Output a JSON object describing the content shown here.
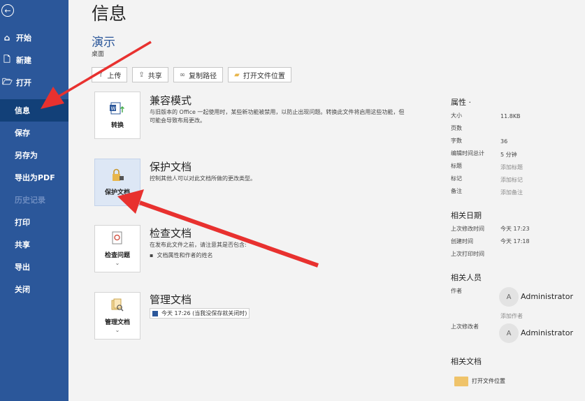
{
  "sidebar": {
    "back_icon": "back-arrow-icon",
    "top_items": [
      {
        "icon": "home-icon",
        "glyph": "⌂",
        "label": "开始"
      },
      {
        "icon": "new-doc-icon",
        "glyph": "🗋",
        "label": "新建"
      },
      {
        "icon": "open-folder-icon",
        "glyph": "🗁",
        "label": "打开"
      }
    ],
    "items": [
      {
        "label": "信息",
        "active": true
      },
      {
        "label": "保存"
      },
      {
        "label": "另存为"
      },
      {
        "label": "导出为PDF"
      },
      {
        "label": "历史记录",
        "disabled": true
      },
      {
        "label": "打印"
      },
      {
        "label": "共享"
      },
      {
        "label": "导出"
      },
      {
        "label": "关闭"
      }
    ]
  },
  "header": {
    "title": "信息",
    "doc_name": "演示",
    "doc_location": "桌面"
  },
  "toolbar": {
    "upload": "上传",
    "share": "共享",
    "copy_path": "复制路径",
    "open_location": "打开文件位置"
  },
  "sections": {
    "compat": {
      "card_label": "转换",
      "title": "兼容模式",
      "desc": "与旧版本的 Office 一起使用时，某些新功能被禁用，以防止出现问题。转换此文件将启用这些功能，但可能会导致布局更改。"
    },
    "protect": {
      "card_label": "保护文档",
      "title": "保护文档",
      "desc": "控制其他人可以对此文档所做的更改类型。"
    },
    "inspect": {
      "card_label": "检查问题",
      "title": "检查文档",
      "desc": "在发布此文件之前，请注意其是否包含:",
      "bullet": "文档属性和作者的姓名"
    },
    "manage": {
      "card_label": "管理文档",
      "title": "管理文档",
      "entry": "今天 17:26 (当我没保存就关闭时)"
    }
  },
  "properties": {
    "title": "属性",
    "rows": [
      {
        "label": "大小",
        "value": "11.8KB"
      },
      {
        "label": "页数",
        "value": ""
      },
      {
        "label": "字数",
        "value": "36"
      },
      {
        "label": "编辑时间总计",
        "value": "5 分钟"
      },
      {
        "label": "标题",
        "value": "添加标题",
        "muted": true
      },
      {
        "label": "标记",
        "value": "添加标记",
        "muted": true
      },
      {
        "label": "备注",
        "value": "添加备注",
        "muted": true
      }
    ],
    "dates_title": "相关日期",
    "dates": [
      {
        "label": "上次修改时间",
        "value": "今天 17:23"
      },
      {
        "label": "创建时间",
        "value": "今天 17:18"
      },
      {
        "label": "上次打印时间",
        "value": ""
      }
    ],
    "people_title": "相关人员",
    "author_label": "作者",
    "author_name": "Administrator",
    "avatar_letter": "A",
    "add_author": "添加作者",
    "last_modified_by_label": "上次修改者",
    "last_modified_by": "Administrator",
    "docs_title": "相关文档",
    "open_location": "打开文件位置"
  },
  "colors": {
    "sidebar": "#2b579a",
    "active": "#124078",
    "arrow": "#e8312f"
  }
}
